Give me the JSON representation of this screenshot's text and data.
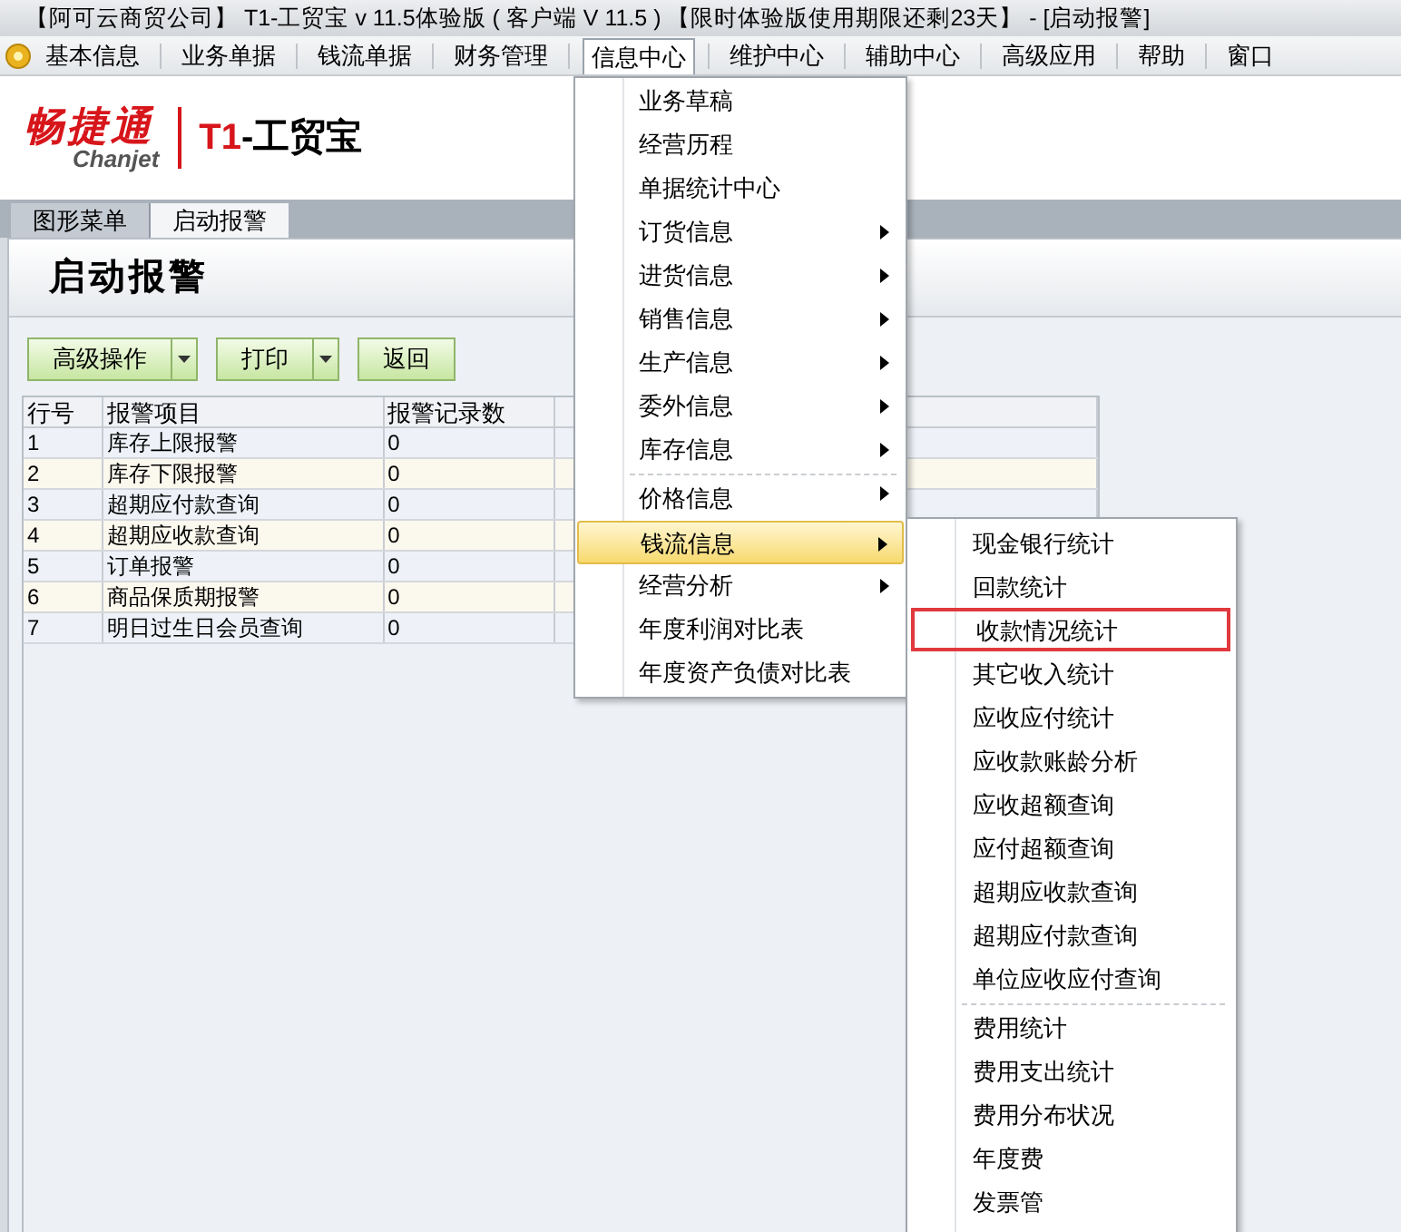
{
  "window": {
    "title": "【阿可云商贸公司】 T1-工贸宝 v 11.5体验版 ( 客户端 V 11.5 ) 【限时体验版使用期限还剩23天】 - [启动报警]"
  },
  "menu_bar": [
    {
      "label": "基本信息",
      "selected": false
    },
    {
      "label": "业务单据",
      "selected": false
    },
    {
      "label": "钱流单据",
      "selected": false
    },
    {
      "label": "财务管理",
      "selected": false
    },
    {
      "label": "信息中心",
      "selected": true
    },
    {
      "label": "维护中心",
      "selected": false
    },
    {
      "label": "辅助中心",
      "selected": false
    },
    {
      "label": "高级应用",
      "selected": false
    },
    {
      "label": "帮助",
      "selected": false
    },
    {
      "label": "窗口",
      "selected": false
    }
  ],
  "logo": {
    "brand": "畅捷通",
    "brand_en": "Chanjet",
    "product_code": "T1",
    "product": "-工贸宝"
  },
  "tabs": [
    {
      "label": "图形菜单",
      "selected": false
    },
    {
      "label": "启动报警",
      "selected": true
    }
  ],
  "page_title": "启动报警",
  "toolbar": [
    {
      "label": "高级操作",
      "dropdown": true
    },
    {
      "label": "打印",
      "dropdown": true
    },
    {
      "label": "返回",
      "dropdown": false
    }
  ],
  "table": {
    "columns": [
      "行号",
      "报警项目",
      "报警记录数"
    ],
    "rows": [
      [
        "1",
        "库存上限报警",
        "0"
      ],
      [
        "2",
        "库存下限报警",
        "0"
      ],
      [
        "3",
        "超期应付款查询",
        "0"
      ],
      [
        "4",
        "超期应收款查询",
        "0"
      ],
      [
        "5",
        "订单报警",
        "0"
      ],
      [
        "6",
        "商品保质期报警",
        "0"
      ],
      [
        "7",
        "明日过生日会员查询",
        "0"
      ]
    ]
  },
  "menu": [
    {
      "label": "业务草稿",
      "submenu": false,
      "separator_before": false,
      "selected": false
    },
    {
      "label": "经营历程",
      "submenu": false,
      "separator_before": false,
      "selected": false
    },
    {
      "label": "单据统计中心",
      "submenu": false,
      "separator_before": false,
      "selected": false
    },
    {
      "label": "订货信息",
      "submenu": true,
      "separator_before": false,
      "selected": false
    },
    {
      "label": "进货信息",
      "submenu": true,
      "separator_before": false,
      "selected": false
    },
    {
      "label": "销售信息",
      "submenu": true,
      "separator_before": false,
      "selected": false
    },
    {
      "label": "生产信息",
      "submenu": true,
      "separator_before": false,
      "selected": false
    },
    {
      "label": "委外信息",
      "submenu": true,
      "separator_before": false,
      "selected": false
    },
    {
      "label": "库存信息",
      "submenu": true,
      "separator_before": false,
      "selected": false
    },
    {
      "label": "价格信息",
      "submenu": true,
      "separator_before": true,
      "selected": false
    },
    {
      "label": "钱流信息",
      "submenu": true,
      "separator_before": false,
      "selected": true
    },
    {
      "label": "经营分析",
      "submenu": true,
      "separator_before": false,
      "selected": false
    },
    {
      "label": "年度利润对比表",
      "submenu": false,
      "separator_before": false,
      "selected": false
    },
    {
      "label": "年度资产负债对比表",
      "submenu": false,
      "separator_before": false,
      "selected": false
    }
  ],
  "submenu": [
    {
      "label": "现金银行统计",
      "separator_before": false,
      "outlined": false
    },
    {
      "label": "回款统计",
      "separator_before": false,
      "outlined": false
    },
    {
      "label": "收款情况统计",
      "separator_before": false,
      "outlined": true
    },
    {
      "label": "其它收入统计",
      "separator_before": false,
      "outlined": false
    },
    {
      "label": "应收应付统计",
      "separator_before": false,
      "outlined": false
    },
    {
      "label": "应收款账龄分析",
      "separator_before": false,
      "outlined": false
    },
    {
      "label": "应收超额查询",
      "separator_before": false,
      "outlined": false
    },
    {
      "label": "应付超额查询",
      "separator_before": false,
      "outlined": false
    },
    {
      "label": "超期应收款查询",
      "separator_before": false,
      "outlined": false
    },
    {
      "label": "超期应付款查询",
      "separator_before": false,
      "outlined": false
    },
    {
      "label": "单位应收应付查询",
      "separator_before": false,
      "outlined": false
    },
    {
      "label": "费用统计",
      "separator_before": true,
      "outlined": false
    },
    {
      "label": "费用支出统计",
      "separator_before": false,
      "outlined": false
    },
    {
      "label": "费用分布状况",
      "separator_before": false,
      "outlined": false
    },
    {
      "label": "年度费",
      "separator_before": false,
      "outlined": false
    },
    {
      "label": "发票管",
      "separator_before": false,
      "outlined": false
    }
  ]
}
